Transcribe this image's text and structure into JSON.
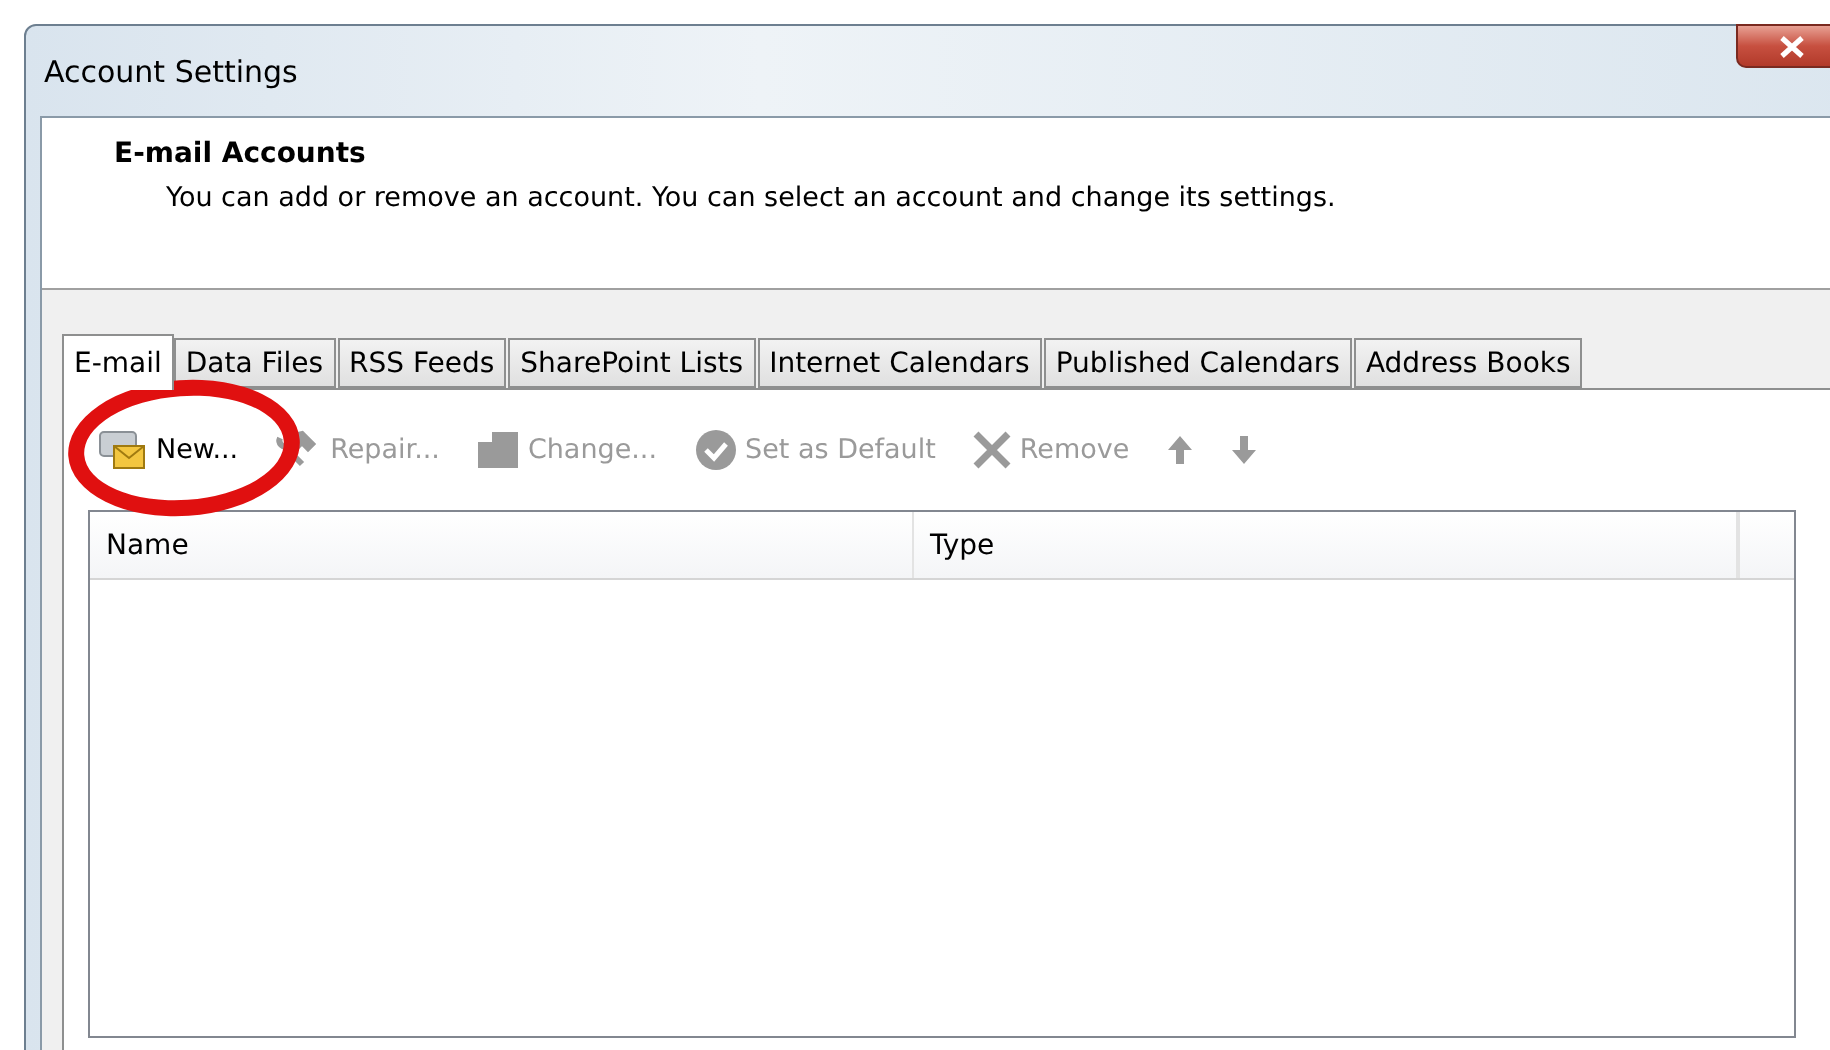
{
  "window": {
    "title": "Account Settings"
  },
  "header": {
    "title": "E-mail Accounts",
    "description": "You can add or remove an account. You can select an account and change its settings."
  },
  "tabs": [
    {
      "label": "E-mail",
      "selected": true
    },
    {
      "label": "Data Files",
      "selected": false
    },
    {
      "label": "RSS Feeds",
      "selected": false
    },
    {
      "label": "SharePoint Lists",
      "selected": false
    },
    {
      "label": "Internet Calendars",
      "selected": false
    },
    {
      "label": "Published Calendars",
      "selected": false
    },
    {
      "label": "Address Books",
      "selected": false
    }
  ],
  "toolbar": [
    {
      "kind": "new",
      "label": "New...",
      "disabled": false,
      "circled": true
    },
    {
      "kind": "repair",
      "label": "Repair...",
      "disabled": true
    },
    {
      "kind": "change",
      "label": "Change...",
      "disabled": true
    },
    {
      "kind": "default",
      "label": "Set as Default",
      "disabled": true
    },
    {
      "kind": "remove",
      "label": "Remove",
      "disabled": true
    },
    {
      "kind": "up",
      "disabled": true
    },
    {
      "kind": "down",
      "disabled": true
    }
  ],
  "table": {
    "columns": [
      "Name",
      "Type"
    ]
  }
}
